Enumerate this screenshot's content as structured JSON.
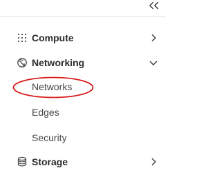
{
  "topbar": {
    "collapse_icon": "double-chevron-left-icon"
  },
  "nav": {
    "groups": [
      {
        "label": "Compute",
        "icon": "grid-dots-icon",
        "expanded": false
      },
      {
        "label": "Networking",
        "icon": "network-globe-icon",
        "expanded": true,
        "items": [
          {
            "label": "Networks",
            "highlighted": true
          },
          {
            "label": "Edges"
          },
          {
            "label": "Security"
          }
        ]
      },
      {
        "label": "Storage",
        "icon": "database-icon",
        "expanded": false
      }
    ]
  },
  "colors": {
    "highlight": "#d91c1c",
    "divider": "#dcdcdc",
    "text_primary": "#2b2b2b",
    "text_secondary": "#454545"
  }
}
